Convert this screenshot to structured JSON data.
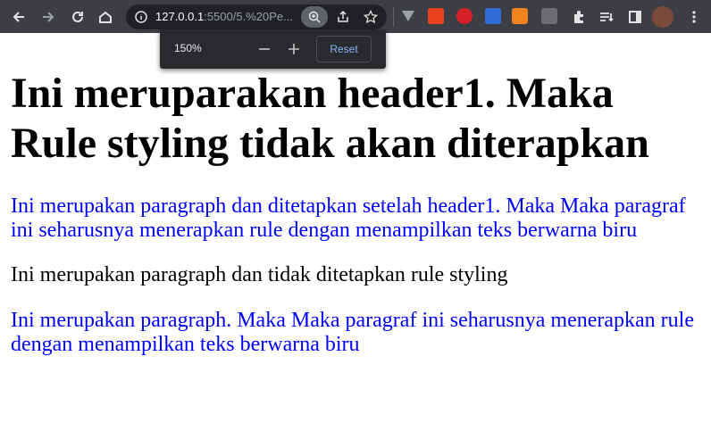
{
  "browser": {
    "url_host": "127.0.0.1",
    "url_path": ":5500/5.%20Pe..."
  },
  "zoom_popup": {
    "level": "150%",
    "minus": "—",
    "plus": "+",
    "reset_label": "Reset"
  },
  "colors": {
    "toolbar": "#3c3e44",
    "omnibox": "#202124",
    "popup": "#292a2d",
    "paragraph_blue": "#0000ff"
  },
  "page": {
    "heading": "Ini meruparakan header1. Maka Rule styling tidak akan diterapkan",
    "paragraph1": "Ini merupakan paragraph dan ditetapkan setelah header1. Maka Maka paragraf ini seharusnya menerapkan rule dengan menampilkan teks berwarna biru",
    "paragraph2": "Ini merupakan paragraph dan tidak ditetapkan rule styling",
    "paragraph3": "Ini merupakan paragraph. Maka Maka paragraf ini seharusnya menerapkan rule dengan menampilkan teks berwarna biru"
  }
}
